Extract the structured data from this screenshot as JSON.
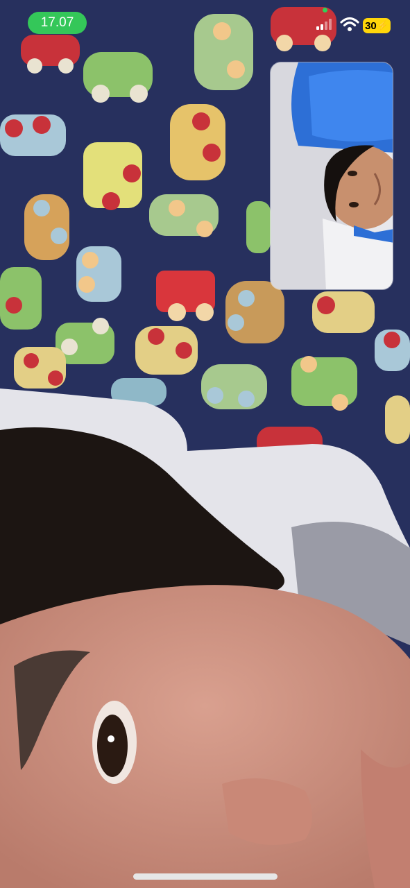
{
  "status_bar": {
    "time": "17.07",
    "battery_level": "30",
    "icons": [
      "camera-in-use-indicator",
      "cellular-signal-icon",
      "wifi-icon",
      "battery-charging-icon"
    ],
    "time_pill_color": "#34c759",
    "battery_color": "#ffd60a"
  },
  "call": {
    "remote_video": "full-screen-remote-camera-feed",
    "local_preview": "self-view-picture-in-picture"
  },
  "home_indicator": "home-bar"
}
